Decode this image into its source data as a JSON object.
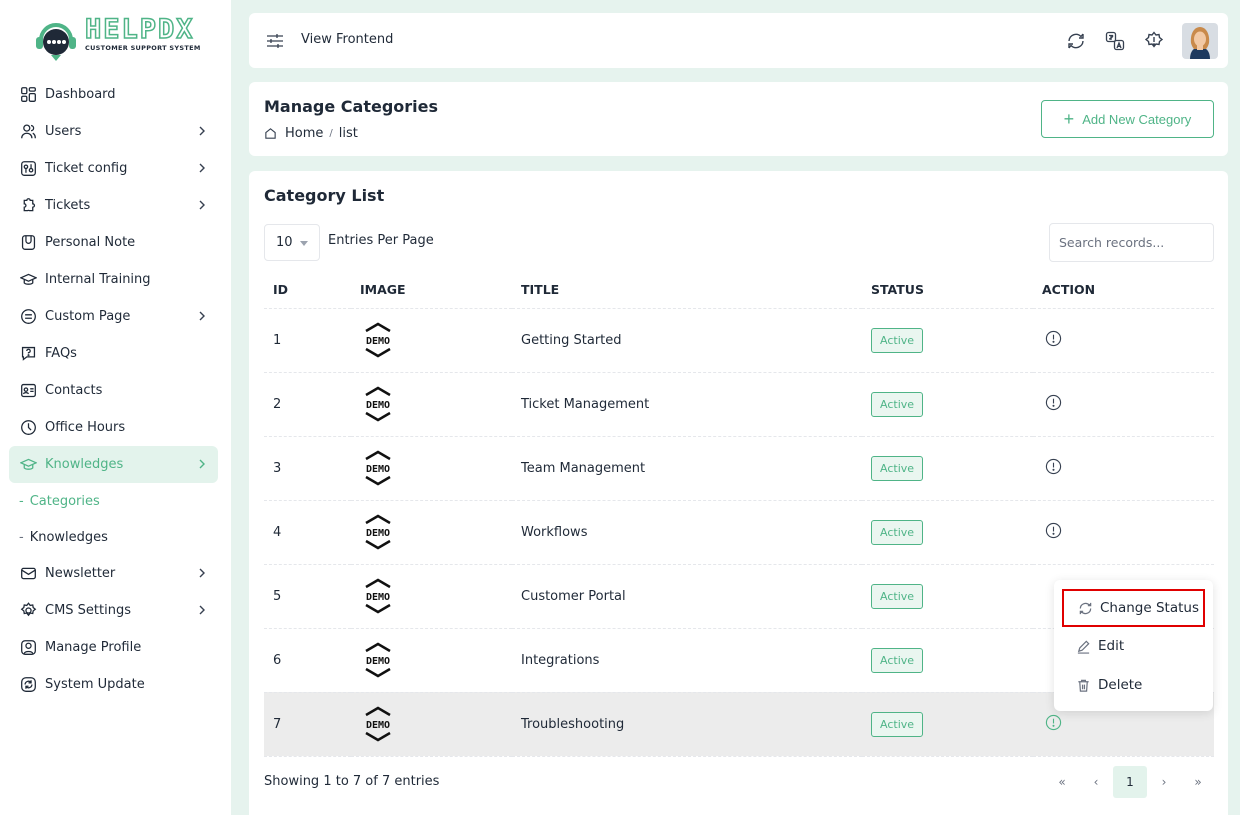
{
  "brand": {
    "name": "HELPDX",
    "tagline": "CUSTOMER SUPPORT SYSTEM",
    "accent_color": "#4fb487"
  },
  "sidebar": {
    "items": [
      {
        "label": "Dashboard",
        "icon": "dashboard-icon",
        "has_children": false
      },
      {
        "label": "Users",
        "icon": "users-icon",
        "has_children": true
      },
      {
        "label": "Ticket config",
        "icon": "ticket-config-icon",
        "has_children": true
      },
      {
        "label": "Tickets",
        "icon": "tickets-icon",
        "has_children": true
      },
      {
        "label": "Personal Note",
        "icon": "note-icon",
        "has_children": false
      },
      {
        "label": "Internal Training",
        "icon": "training-icon",
        "has_children": false
      },
      {
        "label": "Custom Page",
        "icon": "custom-page-icon",
        "has_children": true
      },
      {
        "label": "FAQs",
        "icon": "faq-icon",
        "has_children": false
      },
      {
        "label": "Contacts",
        "icon": "contacts-icon",
        "has_children": false
      },
      {
        "label": "Office Hours",
        "icon": "clock-icon",
        "has_children": false
      },
      {
        "label": "Knowledges",
        "icon": "knowledges-icon",
        "has_children": true,
        "active": true
      },
      {
        "label": "Newsletter",
        "icon": "newsletter-icon",
        "has_children": true
      },
      {
        "label": "CMS Settings",
        "icon": "settings-icon",
        "has_children": true
      },
      {
        "label": "Manage Profile",
        "icon": "profile-icon",
        "has_children": false
      },
      {
        "label": "System Update",
        "icon": "update-icon",
        "has_children": false
      }
    ],
    "subitems": [
      {
        "label": "Categories",
        "active": true
      },
      {
        "label": "Knowledges",
        "active": false
      }
    ]
  },
  "topbar": {
    "view_frontend": "View Frontend"
  },
  "header": {
    "title": "Manage Categories",
    "breadcrumb_home": "Home",
    "breadcrumb_separator": "/",
    "breadcrumb_current": "list",
    "add_button": "Add New Category"
  },
  "list": {
    "title": "Category List",
    "per_page": "10",
    "per_page_label": "Entries Per Page",
    "search_placeholder": "Search records...",
    "columns": [
      "ID",
      "IMAGE",
      "TITLE",
      "STATUS",
      "ACTION"
    ],
    "rows": [
      {
        "id": "1",
        "image": "DEMO",
        "title": "Getting Started",
        "status": "Active"
      },
      {
        "id": "2",
        "image": "DEMO",
        "title": "Ticket Management",
        "status": "Active"
      },
      {
        "id": "3",
        "image": "DEMO",
        "title": "Team Management",
        "status": "Active"
      },
      {
        "id": "4",
        "image": "DEMO",
        "title": "Workflows",
        "status": "Active"
      },
      {
        "id": "5",
        "image": "DEMO",
        "title": "Customer Portal",
        "status": "Active"
      },
      {
        "id": "6",
        "image": "DEMO",
        "title": "Integrations",
        "status": "Active"
      },
      {
        "id": "7",
        "image": "DEMO",
        "title": "Troubleshooting",
        "status": "Active"
      }
    ],
    "footer": "Showing 1 to 7 of 7 entries",
    "pagination": {
      "first": "«",
      "prev": "‹",
      "current": "1",
      "next": "›",
      "last": "»"
    }
  },
  "dropdown": {
    "change_status": "Change Status",
    "edit": "Edit",
    "delete": "Delete"
  }
}
